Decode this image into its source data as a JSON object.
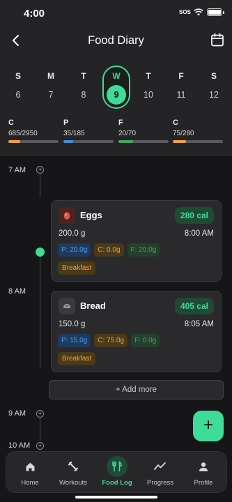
{
  "status_bar": {
    "time": "4:00",
    "sos": "SOS"
  },
  "header": {
    "title": "Food Diary"
  },
  "week": [
    {
      "letter": "S",
      "num": "6"
    },
    {
      "letter": "M",
      "num": "7"
    },
    {
      "letter": "T",
      "num": "8"
    },
    {
      "letter": "W",
      "num": "9",
      "selected": true
    },
    {
      "letter": "T",
      "num": "10"
    },
    {
      "letter": "F",
      "num": "11"
    },
    {
      "letter": "S",
      "num": "12"
    }
  ],
  "macros": [
    {
      "label": "C",
      "value": "685/2950",
      "progress": 0.232,
      "color": "#f0a43a"
    },
    {
      "label": "P",
      "value": "35/185",
      "progress": 0.19,
      "color": "#3b8fe0"
    },
    {
      "label": "F",
      "value": "20/70",
      "progress": 0.286,
      "color": "#3fa865"
    },
    {
      "label": "C",
      "value": "75/280",
      "progress": 0.268,
      "color": "#f0a43a"
    }
  ],
  "timeline": {
    "hours": [
      "7 AM",
      "8 AM",
      "9 AM",
      "10 AM"
    ],
    "add_more": "+ Add more"
  },
  "entries": [
    {
      "name": "Eggs",
      "calories": "280 cal",
      "quantity": "200.0 g",
      "time": "8:00 AM",
      "protein": "P: 20.0g",
      "carbs": "C: 0.0g",
      "fat": "F: 20.0g",
      "meal": "Breakfast",
      "icon": "egg-icon",
      "icon_bg": "#4a2323"
    },
    {
      "name": "Bread",
      "calories": "405 cal",
      "quantity": "150.0 g",
      "time": "8:05 AM",
      "protein": "P: 15.0g",
      "carbs": "C: 75.0g",
      "fat": "F: 0.0g",
      "meal": "Breakfast",
      "icon": "bread-icon",
      "icon_bg": "#3a3a3c"
    }
  ],
  "bottom_nav": [
    {
      "label": "Home",
      "icon": "home-icon"
    },
    {
      "label": "Workouts",
      "icon": "workouts-icon"
    },
    {
      "label": "Food Log",
      "icon": "food-log-icon",
      "active": true
    },
    {
      "label": "Progress",
      "icon": "progress-icon"
    },
    {
      "label": "Profile",
      "icon": "profile-icon"
    }
  ],
  "colors": {
    "accent": "#3ddc97",
    "background": "#161618",
    "header": "#242426"
  }
}
